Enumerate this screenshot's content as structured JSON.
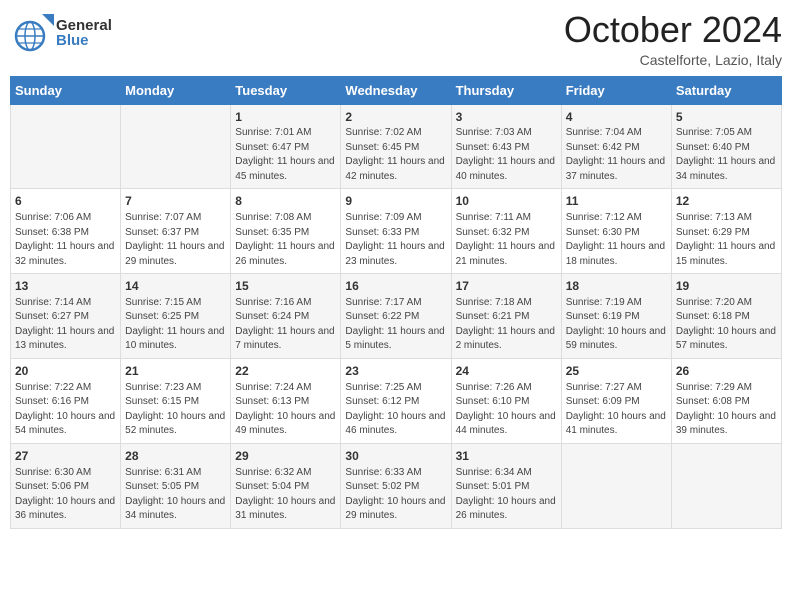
{
  "header": {
    "logo_general": "General",
    "logo_blue": "Blue",
    "month_title": "October 2024",
    "location": "Castelforte, Lazio, Italy"
  },
  "calendar": {
    "days_of_week": [
      "Sunday",
      "Monday",
      "Tuesday",
      "Wednesday",
      "Thursday",
      "Friday",
      "Saturday"
    ],
    "weeks": [
      [
        {
          "day": "",
          "info": ""
        },
        {
          "day": "",
          "info": ""
        },
        {
          "day": "1",
          "info": "Sunrise: 7:01 AM\nSunset: 6:47 PM\nDaylight: 11 hours and 45 minutes."
        },
        {
          "day": "2",
          "info": "Sunrise: 7:02 AM\nSunset: 6:45 PM\nDaylight: 11 hours and 42 minutes."
        },
        {
          "day": "3",
          "info": "Sunrise: 7:03 AM\nSunset: 6:43 PM\nDaylight: 11 hours and 40 minutes."
        },
        {
          "day": "4",
          "info": "Sunrise: 7:04 AM\nSunset: 6:42 PM\nDaylight: 11 hours and 37 minutes."
        },
        {
          "day": "5",
          "info": "Sunrise: 7:05 AM\nSunset: 6:40 PM\nDaylight: 11 hours and 34 minutes."
        }
      ],
      [
        {
          "day": "6",
          "info": "Sunrise: 7:06 AM\nSunset: 6:38 PM\nDaylight: 11 hours and 32 minutes."
        },
        {
          "day": "7",
          "info": "Sunrise: 7:07 AM\nSunset: 6:37 PM\nDaylight: 11 hours and 29 minutes."
        },
        {
          "day": "8",
          "info": "Sunrise: 7:08 AM\nSunset: 6:35 PM\nDaylight: 11 hours and 26 minutes."
        },
        {
          "day": "9",
          "info": "Sunrise: 7:09 AM\nSunset: 6:33 PM\nDaylight: 11 hours and 23 minutes."
        },
        {
          "day": "10",
          "info": "Sunrise: 7:11 AM\nSunset: 6:32 PM\nDaylight: 11 hours and 21 minutes."
        },
        {
          "day": "11",
          "info": "Sunrise: 7:12 AM\nSunset: 6:30 PM\nDaylight: 11 hours and 18 minutes."
        },
        {
          "day": "12",
          "info": "Sunrise: 7:13 AM\nSunset: 6:29 PM\nDaylight: 11 hours and 15 minutes."
        }
      ],
      [
        {
          "day": "13",
          "info": "Sunrise: 7:14 AM\nSunset: 6:27 PM\nDaylight: 11 hours and 13 minutes."
        },
        {
          "day": "14",
          "info": "Sunrise: 7:15 AM\nSunset: 6:25 PM\nDaylight: 11 hours and 10 minutes."
        },
        {
          "day": "15",
          "info": "Sunrise: 7:16 AM\nSunset: 6:24 PM\nDaylight: 11 hours and 7 minutes."
        },
        {
          "day": "16",
          "info": "Sunrise: 7:17 AM\nSunset: 6:22 PM\nDaylight: 11 hours and 5 minutes."
        },
        {
          "day": "17",
          "info": "Sunrise: 7:18 AM\nSunset: 6:21 PM\nDaylight: 11 hours and 2 minutes."
        },
        {
          "day": "18",
          "info": "Sunrise: 7:19 AM\nSunset: 6:19 PM\nDaylight: 10 hours and 59 minutes."
        },
        {
          "day": "19",
          "info": "Sunrise: 7:20 AM\nSunset: 6:18 PM\nDaylight: 10 hours and 57 minutes."
        }
      ],
      [
        {
          "day": "20",
          "info": "Sunrise: 7:22 AM\nSunset: 6:16 PM\nDaylight: 10 hours and 54 minutes."
        },
        {
          "day": "21",
          "info": "Sunrise: 7:23 AM\nSunset: 6:15 PM\nDaylight: 10 hours and 52 minutes."
        },
        {
          "day": "22",
          "info": "Sunrise: 7:24 AM\nSunset: 6:13 PM\nDaylight: 10 hours and 49 minutes."
        },
        {
          "day": "23",
          "info": "Sunrise: 7:25 AM\nSunset: 6:12 PM\nDaylight: 10 hours and 46 minutes."
        },
        {
          "day": "24",
          "info": "Sunrise: 7:26 AM\nSunset: 6:10 PM\nDaylight: 10 hours and 44 minutes."
        },
        {
          "day": "25",
          "info": "Sunrise: 7:27 AM\nSunset: 6:09 PM\nDaylight: 10 hours and 41 minutes."
        },
        {
          "day": "26",
          "info": "Sunrise: 7:29 AM\nSunset: 6:08 PM\nDaylight: 10 hours and 39 minutes."
        }
      ],
      [
        {
          "day": "27",
          "info": "Sunrise: 6:30 AM\nSunset: 5:06 PM\nDaylight: 10 hours and 36 minutes."
        },
        {
          "day": "28",
          "info": "Sunrise: 6:31 AM\nSunset: 5:05 PM\nDaylight: 10 hours and 34 minutes."
        },
        {
          "day": "29",
          "info": "Sunrise: 6:32 AM\nSunset: 5:04 PM\nDaylight: 10 hours and 31 minutes."
        },
        {
          "day": "30",
          "info": "Sunrise: 6:33 AM\nSunset: 5:02 PM\nDaylight: 10 hours and 29 minutes."
        },
        {
          "day": "31",
          "info": "Sunrise: 6:34 AM\nSunset: 5:01 PM\nDaylight: 10 hours and 26 minutes."
        },
        {
          "day": "",
          "info": ""
        },
        {
          "day": "",
          "info": ""
        }
      ]
    ]
  }
}
